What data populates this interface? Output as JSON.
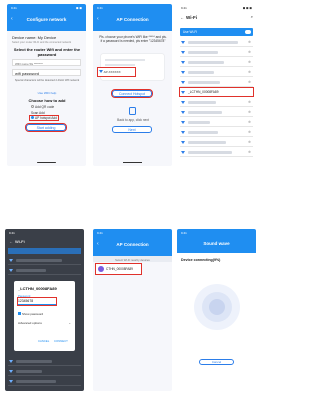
{
  "panel1": {
    "status_left": "9:41",
    "status_right": "◼ ◼",
    "title": "Configure network",
    "device_name_label": "Device name: My Device",
    "hint": "Select your router Wi-Fi and the connected network",
    "select_heading": "Select the router Wifi and enter the password",
    "ssid_value": "WIFI name 5G ********",
    "password_label": "wifi password",
    "password_hint": "Special characters will be detected 2.4GHz Wifi network",
    "ssid_link": "Use WiFi help",
    "choose_heading": "Choose how to add",
    "option_ap": "Add QR code",
    "option_smart": "Scan Add",
    "option_hotspot": "AP hotspot Add",
    "start_button": "Start adding"
  },
  "panel2": {
    "status_left": "9:41",
    "title": "AP Connection",
    "instructions": "Pls. choose your phone's WiFi like ***** and pls. if a password is needed, pls enter \"12345678\"",
    "ssid_value": "AP-XXXXXX",
    "connect_button": "Connect Hotspot",
    "back_note": "Back to app, click next",
    "next_button": "Next"
  },
  "panel3": {
    "status_left": "9:41",
    "status_right": "◼ ◼ ◼",
    "title": "Wi-Fi",
    "wifi_label": "Use Wi-Fi",
    "highlight_ssid": "_LCTHN_00008FA89"
  },
  "panel4": {
    "status_left": "9:41",
    "title": "Wi-Fi",
    "dialog_title": "_LCTHN_00008FA89",
    "password_label": "Password",
    "password_value": "12345678",
    "show_password": "Show password",
    "advanced": "Advanced options",
    "cancel": "CANCEL",
    "connect": "CONNECT"
  },
  "panel5": {
    "status_left": "9:41",
    "title": "AP Connection",
    "section_label": "Select Wi-Fi nearby devices",
    "device_name": "CTHN_00008FA89"
  },
  "panel6": {
    "status_left": "9:41",
    "title": "Sound wave",
    "connecting": "Device connecting(9%)",
    "cancel": "Cancel"
  },
  "colors": {
    "accent": "#1f8ef1",
    "highlight_red": "#e0312b",
    "dark_bg": "#3a3f48"
  }
}
